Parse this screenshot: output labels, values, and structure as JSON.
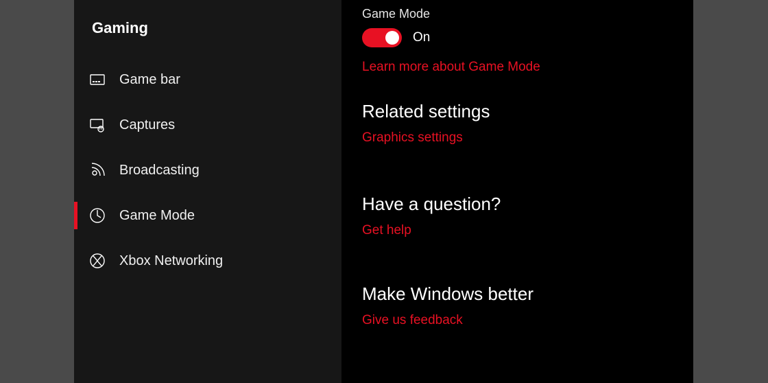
{
  "sidebar": {
    "title": "Gaming",
    "items": [
      {
        "label": "Game bar"
      },
      {
        "label": "Captures"
      },
      {
        "label": "Broadcasting"
      },
      {
        "label": "Game Mode"
      },
      {
        "label": "Xbox Networking"
      }
    ]
  },
  "content": {
    "game_mode_label": "Game Mode",
    "toggle_state": "On",
    "learn_more": "Learn more about Game Mode",
    "related_heading": "Related settings",
    "graphics_link": "Graphics settings",
    "question_heading": "Have a question?",
    "get_help": "Get help",
    "improve_heading": "Make Windows better",
    "feedback_link": "Give us feedback"
  },
  "accent_color": "#e81123"
}
